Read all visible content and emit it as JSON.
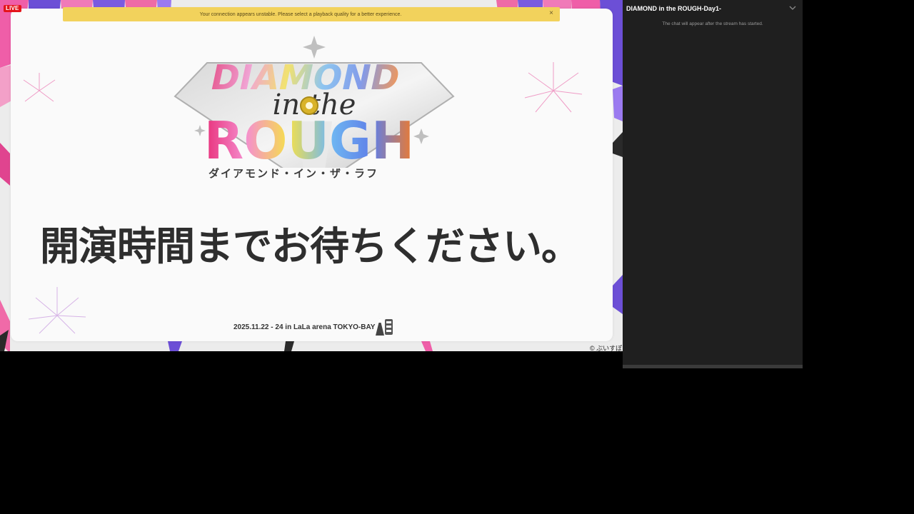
{
  "player": {
    "live_badge": "LIVE",
    "banner": {
      "message": "Your connection appears unstable. Please select a playback quality for a better experience.",
      "close_glyph": "×"
    },
    "screen": {
      "logo": {
        "line1": "DIAMOND",
        "line2": "in the",
        "line3": "ROUGH",
        "kana": "ダイアモンド・イン・ザ・ラフ"
      },
      "message": "開演時間までお待ちください。",
      "event_info": "2025.11.22 - 24 in LaLa arena TOKYO-BAY",
      "copyright": "© ぶいすぽ"
    },
    "colors": {
      "live_red": "#e4141b",
      "banner_yellow": "#f2d25c"
    }
  },
  "chat": {
    "title": "DIAMOND in the ROUGH-Day1-",
    "placeholder": "The chat will appear after the stream has started.",
    "toggle_icon": "chevron-down-icon",
    "colors": {
      "panel_bg": "#1f1f1f"
    }
  }
}
